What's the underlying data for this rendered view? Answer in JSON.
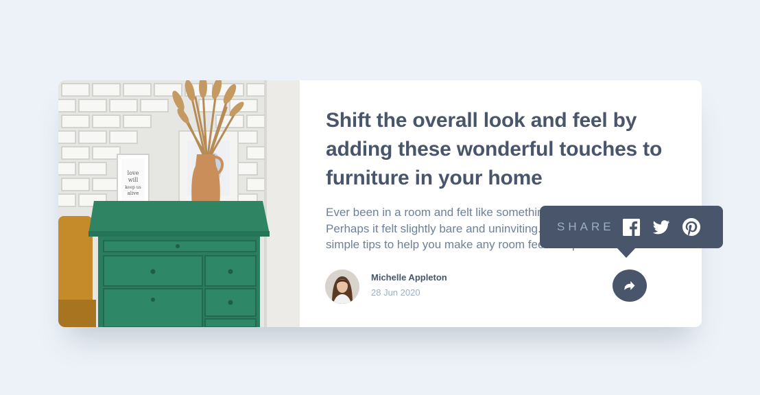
{
  "article": {
    "title": "Shift the overall look and feel by adding these wonderful touches to furniture in your home",
    "excerpt": "Ever been in a room and felt like something was missing? Perhaps it felt slightly bare and uninviting. I’ve got some simple tips to help you make any room feel complete.",
    "image_icon": "drawers-photo"
  },
  "author": {
    "name": "Michelle Appleton",
    "date": "28 Jun 2020",
    "avatar_icon": "avatar-photo"
  },
  "share": {
    "label": "SHARE",
    "button_icon": "share-arrow-icon",
    "networks": [
      {
        "name": "facebook-icon"
      },
      {
        "name": "twitter-icon"
      },
      {
        "name": "pinterest-icon"
      }
    ]
  },
  "colors": {
    "background": "#ecf2f8",
    "dark_blue": "#48556a",
    "grayish_blue": "#6e8098",
    "light_grayish_blue": "#9eafc2",
    "white": "#ffffff"
  }
}
